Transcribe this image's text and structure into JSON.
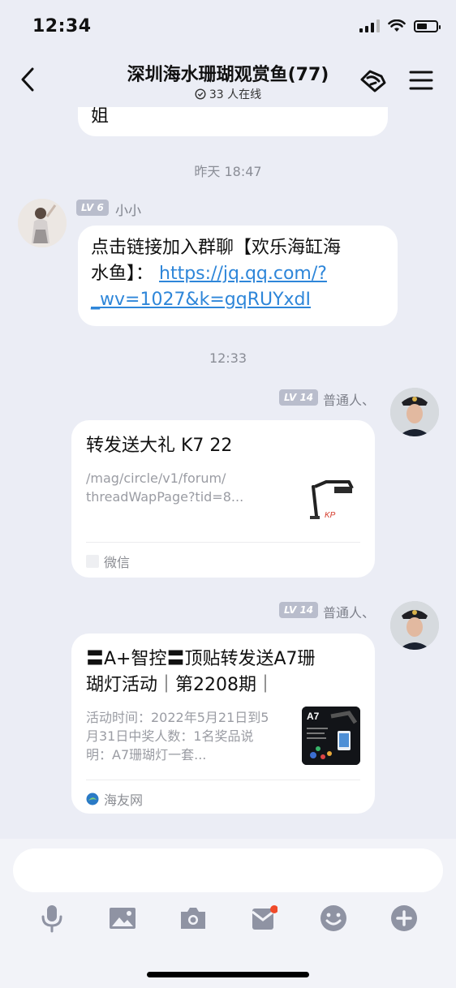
{
  "status_bar": {
    "time": "12:34"
  },
  "header": {
    "title": "深圳海水珊瑚观赏鱼(77)",
    "online": "33 人在线"
  },
  "messages": {
    "partial_text": "姐",
    "time_1": "昨天 18:47",
    "msg1": {
      "level": "LV 6",
      "name": "小小",
      "text_line1": "点击链接加入群聊【欢乐海缸海",
      "text_line2_prefix": "水鱼】：",
      "link_line1": "https://jq.qq.com/?",
      "link_line2": "_wv=1027&k=gqRUYxdI"
    },
    "time_2": "12:33",
    "msg2": {
      "level": "LV 14",
      "name": "普通人、",
      "card_title": "转发送大礼 K7 22",
      "desc_line1": "/mag/circle/v1/forum/",
      "desc_line2": "threadWapPage?tid=8...",
      "thumb_text": "KP",
      "source": "微信"
    },
    "msg3": {
      "level": "LV 14",
      "name": "普通人、",
      "card_title_line1": "〓A+智控〓顶贴转发送A7珊",
      "card_title_line2": "瑚灯活动｜第2208期｜",
      "desc_line1": "活动时间：2022年5月21日到5",
      "desc_line2": "月31日中奖人数：1名奖品说",
      "desc_line3": "明：A7珊瑚灯一套...",
      "thumb_text": "A7",
      "source": "海友网"
    }
  },
  "input": {
    "placeholder": ""
  },
  "toolbar": {
    "icons": [
      "microphone-icon",
      "image-icon",
      "camera-icon",
      "red-packet-icon",
      "emoji-icon",
      "plus-icon"
    ]
  },
  "colors": {
    "link": "#2e86d9",
    "badge": "#b9bdcc",
    "notification_dot": "#f04a2a"
  }
}
